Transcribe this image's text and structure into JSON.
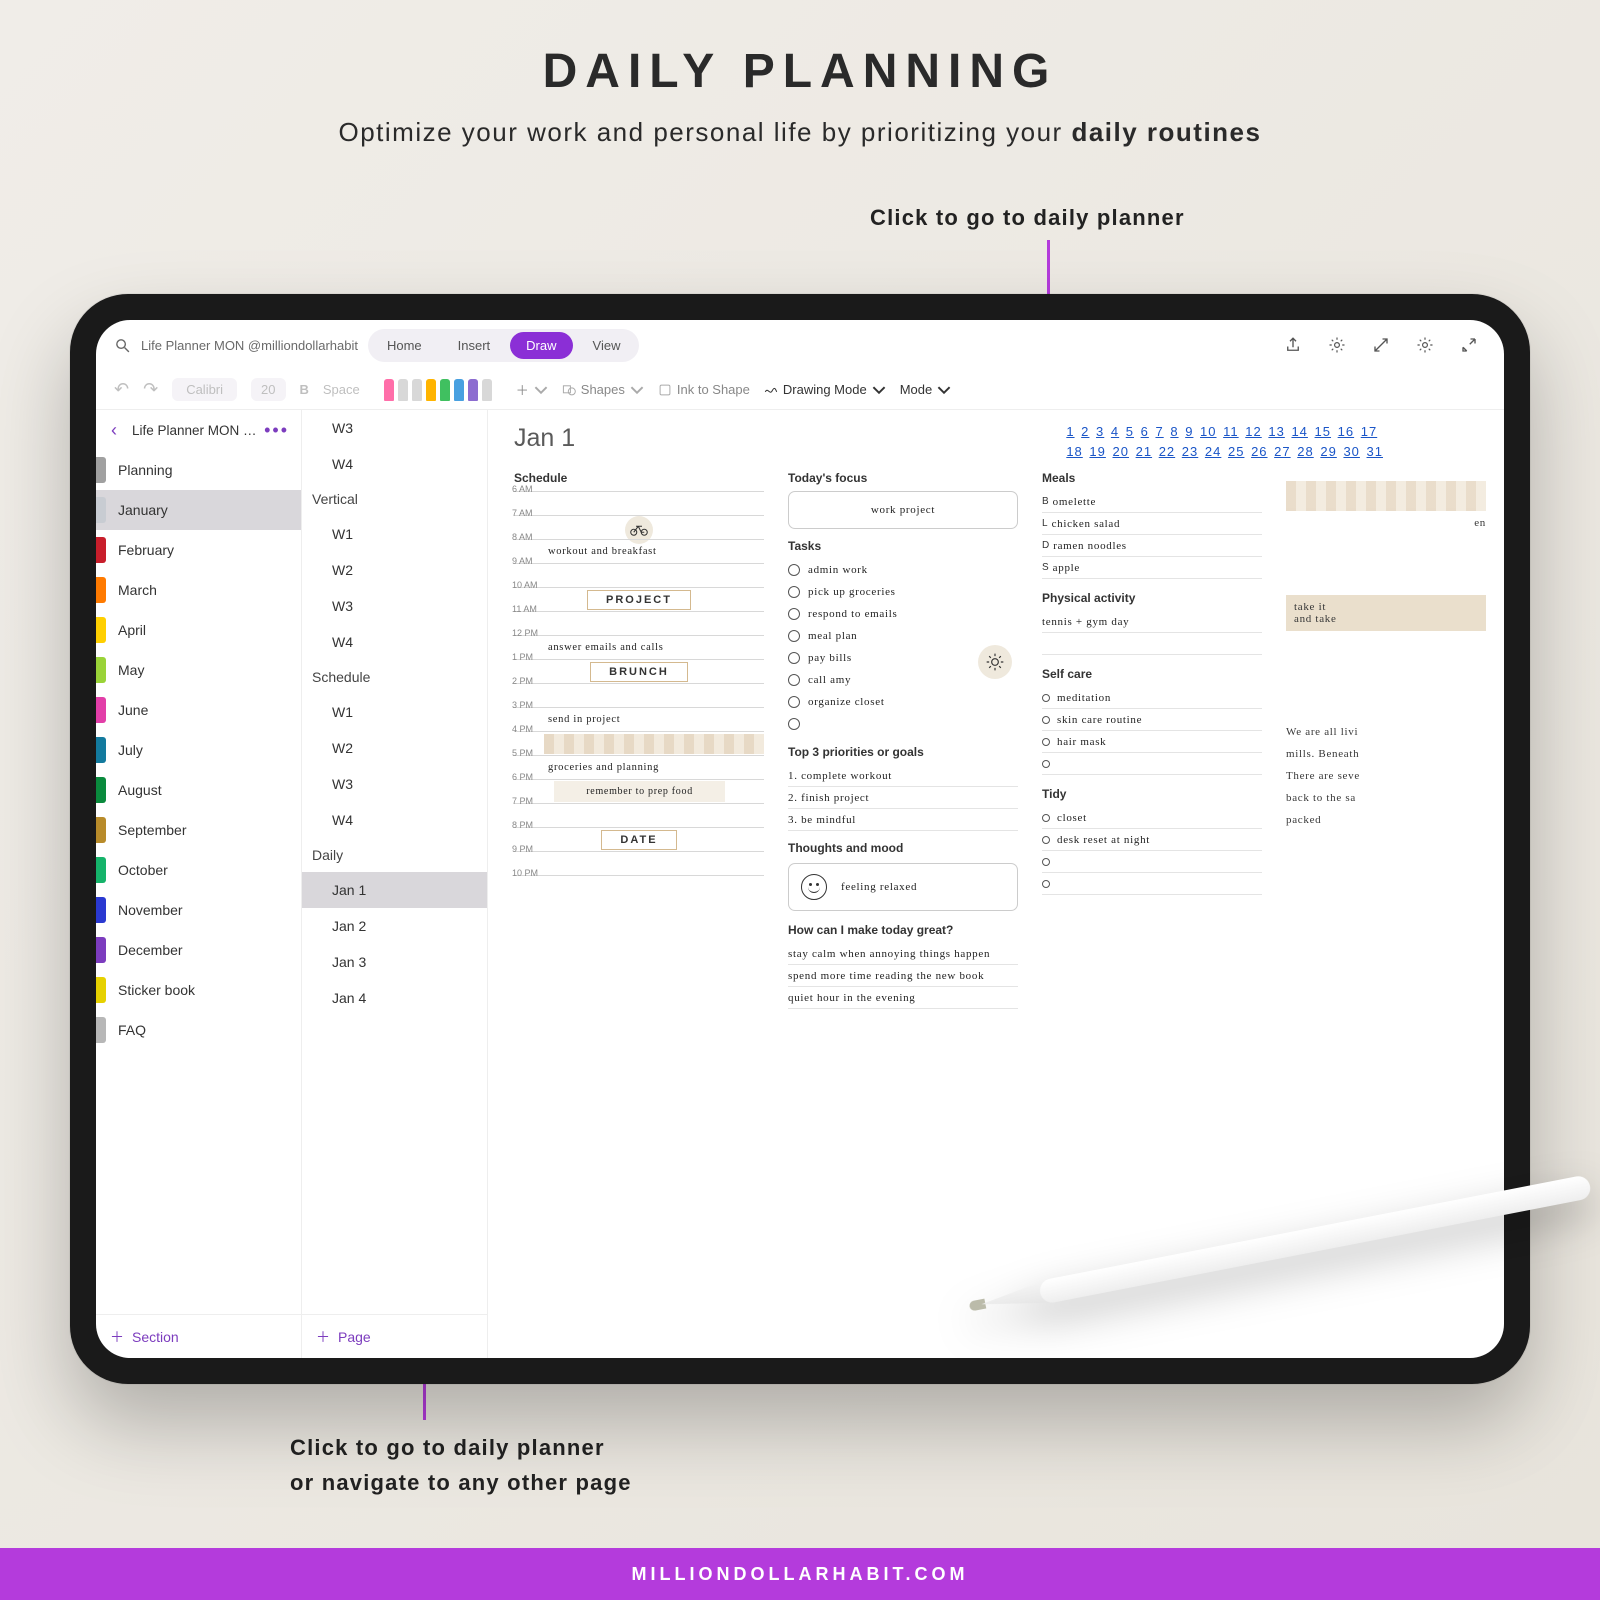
{
  "hero": {
    "title": "DAILY PLANNING",
    "subtitle_a": "Optimize your work and personal life by prioritizing your ",
    "subtitle_b": "daily routines"
  },
  "callouts": {
    "top": "Click to go to daily planner",
    "bottom_a": "Click to go to daily planner",
    "bottom_b": "or navigate to any other page"
  },
  "toolbar": {
    "search_text": "Life Planner MON @milliondollarhabit",
    "tabs": [
      "Home",
      "Insert",
      "Draw",
      "View"
    ],
    "active_tab": "Draw",
    "font_name": "Calibri",
    "font_size": "20",
    "shapes": "Shapes",
    "ink_shape": "Ink to Shape",
    "drawing_mode": "Drawing Mode",
    "mode": "Mode",
    "undo": "↶",
    "redo": "↷",
    "bold": "B",
    "space": "Space"
  },
  "nb": {
    "title": "Life Planner MON @milliondollarhabit",
    "items": [
      {
        "label": "Planning",
        "color": "#a0a0a0"
      },
      {
        "label": "January",
        "color": "#c8ccd2",
        "selected": true
      },
      {
        "label": "February",
        "color": "#c81e2b"
      },
      {
        "label": "March",
        "color": "#ff7a00"
      },
      {
        "label": "April",
        "color": "#ffcf00"
      },
      {
        "label": "May",
        "color": "#9ad338"
      },
      {
        "label": "June",
        "color": "#e23ea8"
      },
      {
        "label": "July",
        "color": "#137a9e"
      },
      {
        "label": "August",
        "color": "#0a8a3d"
      },
      {
        "label": "September",
        "color": "#b88b2a"
      },
      {
        "label": "October",
        "color": "#15b36a"
      },
      {
        "label": "November",
        "color": "#2a39d1"
      },
      {
        "label": "December",
        "color": "#7c3cbe"
      },
      {
        "label": "Sticker book",
        "color": "#e6d100"
      },
      {
        "label": "FAQ",
        "color": "#b7b7b7"
      }
    ],
    "add_section": "Section"
  },
  "pages": {
    "groups": [
      {
        "head": null,
        "items": [
          "W3",
          "W4"
        ]
      },
      {
        "head": "Vertical",
        "items": [
          "W1",
          "W2",
          "W3",
          "W4"
        ]
      },
      {
        "head": "Schedule",
        "items": [
          "W1",
          "W2",
          "W3",
          "W4"
        ]
      },
      {
        "head": "Daily",
        "items": [
          "Jan 1",
          "Jan 2",
          "Jan 3",
          "Jan 4"
        ]
      }
    ],
    "selected": "Jan 1",
    "add_page": "Page"
  },
  "canvas": {
    "title": "Jan 1",
    "dates_row1": [
      "1",
      "2",
      "3",
      "4",
      "5",
      "6",
      "7",
      "8",
      "9",
      "10",
      "11",
      "12",
      "13",
      "14",
      "15",
      "16",
      "17"
    ],
    "dates_row2": [
      "18",
      "19",
      "20",
      "21",
      "22",
      "23",
      "24",
      "25",
      "26",
      "27",
      "28",
      "29",
      "30",
      "31"
    ],
    "schedule_label": "Schedule",
    "schedule": [
      {
        "t": "6 AM",
        "txt": ""
      },
      {
        "t": "7 AM",
        "txt": "",
        "icon": "bike"
      },
      {
        "t": "8 AM",
        "txt": "workout and breakfast"
      },
      {
        "t": "9 AM",
        "txt": ""
      },
      {
        "t": "10 AM",
        "txt": "",
        "block": "PROJECT"
      },
      {
        "t": "11 AM",
        "txt": ""
      },
      {
        "t": "12 PM",
        "txt": "answer emails and calls"
      },
      {
        "t": "1 PM",
        "txt": "",
        "block": "BRUNCH"
      },
      {
        "t": "2 PM",
        "txt": ""
      },
      {
        "t": "3 PM",
        "txt": "send in project"
      },
      {
        "t": "4 PM",
        "txt": "",
        "sticky": true
      },
      {
        "t": "5 PM",
        "txt": "groceries and planning"
      },
      {
        "t": "6 PM",
        "txt": "",
        "sticky_note": "remember to prep food"
      },
      {
        "t": "7 PM",
        "txt": ""
      },
      {
        "t": "8 PM",
        "txt": "",
        "block": "DATE"
      },
      {
        "t": "9 PM",
        "txt": ""
      },
      {
        "t": "10 PM",
        "txt": ""
      }
    ],
    "focus_label": "Today's focus",
    "focus": "work project",
    "tasks_label": "Tasks",
    "tasks": [
      "admin work",
      "pick up groceries",
      "respond to emails",
      "meal plan",
      "pay bills",
      "call amy",
      "organize closet",
      ""
    ],
    "priorities_label": "Top 3 priorities or goals",
    "priorities": [
      "1. complete workout",
      "2. finish project",
      "3. be mindful"
    ],
    "mood_label": "Thoughts and mood",
    "mood_text": "feeling relaxed",
    "q_label": "How can I make today great?",
    "q_lines": [
      "stay calm when annoying things happen",
      "spend more time reading the new book",
      "quiet hour in the evening"
    ],
    "meals_label": "Meals",
    "meals": [
      [
        "B",
        "omelette"
      ],
      [
        "L",
        "chicken salad"
      ],
      [
        "D",
        "ramen noodles"
      ],
      [
        "S",
        "apple"
      ]
    ],
    "activity_label": "Physical activity",
    "activity": "tennis + gym day",
    "selfcare_label": "Self care",
    "selfcare": [
      "meditation",
      "skin care routine",
      "hair mask",
      ""
    ],
    "tidy_label": "Tidy",
    "tidy": [
      "closet",
      "desk reset at night",
      "",
      ""
    ],
    "right_snip": [
      "en",
      "take it",
      "and take"
    ],
    "quote": [
      "We are all livi",
      "mills. Beneath",
      "There are seve",
      "back to the sa",
      "packed"
    ]
  },
  "footer": "MILLIONDOLLARHABIT.COM"
}
